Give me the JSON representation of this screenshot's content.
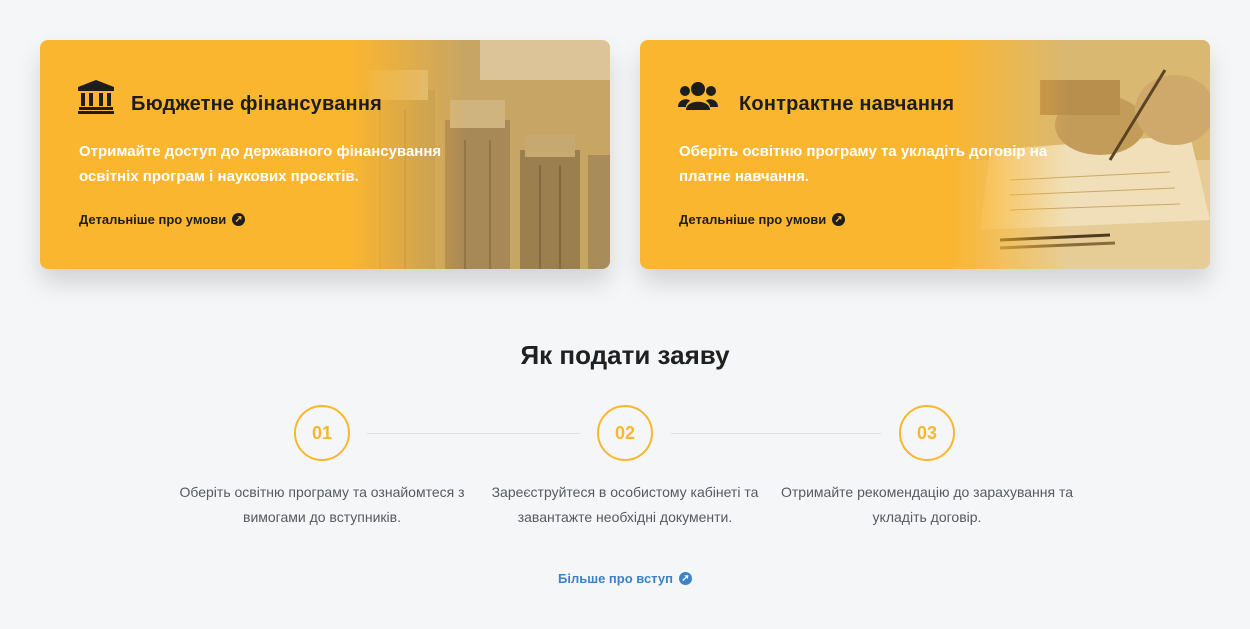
{
  "cards": [
    {
      "title": "Бюджетне фінансування",
      "description": "Отримайте доступ до державного фінансування освітніх програм і наукових проєктів.",
      "link_label": "Детальніше про умови",
      "icon": "bank-icon"
    },
    {
      "title": "Контрактне навчання",
      "description": "Оберіть освітню програму та укладіть договір на платне навчання.",
      "link_label": "Детальніше про умови",
      "icon": "users-icon"
    }
  ],
  "steps_section": {
    "title": "Як подати заяву",
    "steps": [
      {
        "number": "01",
        "text": "Оберіть освітню програму та ознайомтеся з вимогами до вступників."
      },
      {
        "number": "02",
        "text": "Зареєструйтеся в особистому кабінеті та завантажте необхідні документи."
      },
      {
        "number": "03",
        "text": "Отримайте рекомендацію до зарахування та укладіть договір."
      }
    ]
  },
  "footer_link": {
    "label": "Більше про вступ"
  },
  "colors": {
    "accent": "#fbb630",
    "link": "#3d82c9",
    "background": "#f5f6f8"
  }
}
